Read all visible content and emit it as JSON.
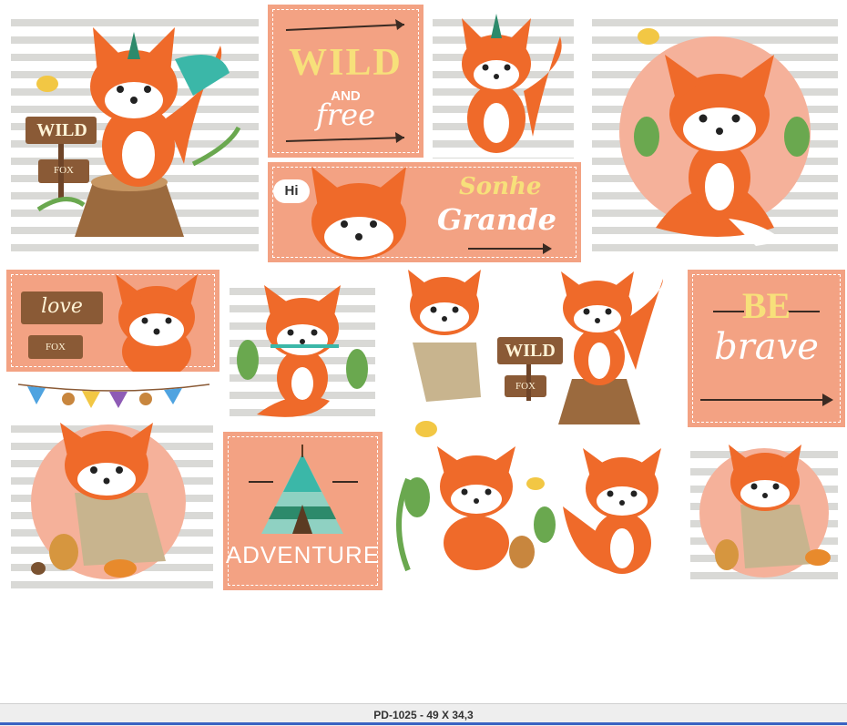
{
  "panels": {
    "wild_free": {
      "line1": "WILD",
      "line2": "AND",
      "line3": "free"
    },
    "sonhe": {
      "line1": "Sonhe",
      "line2": "Grande",
      "bubble": "Hi"
    },
    "be_brave": {
      "line1": "BE",
      "line2": "brave"
    },
    "adventure": {
      "line1": "ADVENTURE"
    },
    "love_fox": {
      "sign1": "love",
      "sign2": "FOX"
    },
    "wild_fox_sign": {
      "sign1": "WILD",
      "sign2": "FOX"
    },
    "wild_fox_sign_2": {
      "sign1": "WILD",
      "sign2": "FOX"
    }
  },
  "footer": {
    "caption": "PD-1025 - 49 X 34,3"
  },
  "colors": {
    "peach": "#f3a283",
    "fox_orange": "#ef6a2a",
    "yellow_text": "#f7e07a",
    "leaf_green": "#6aa84f",
    "teal": "#3bb7a8"
  }
}
